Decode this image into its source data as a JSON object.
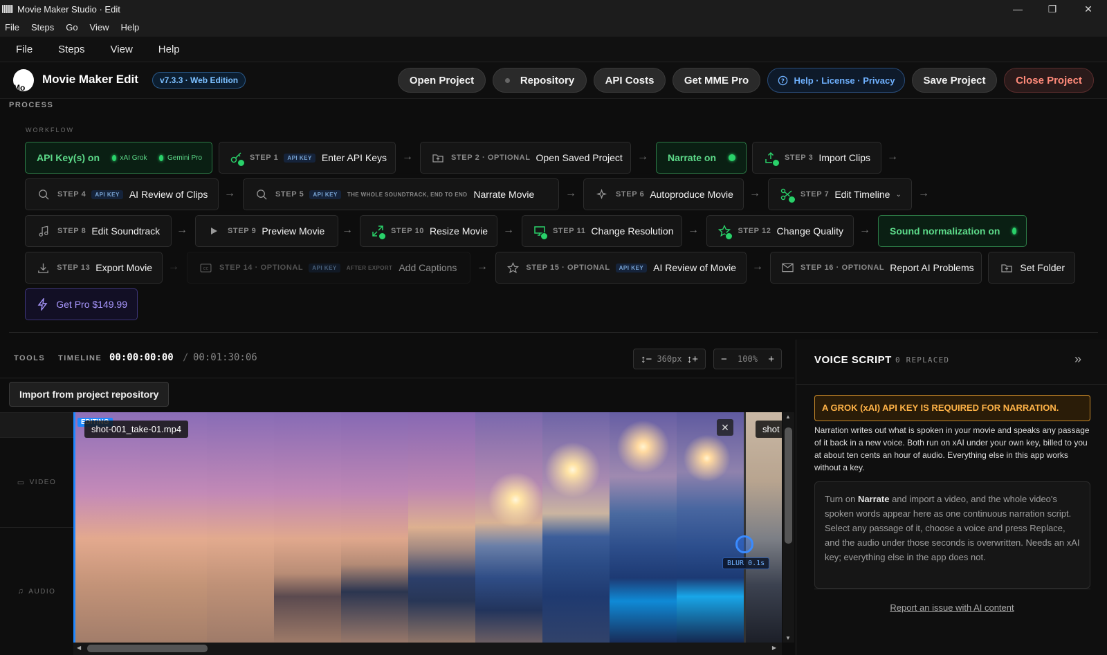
{
  "window": {
    "title": "Movie Maker Studio · Edit",
    "minimize": "—",
    "maximize": "❐",
    "close": "✕"
  },
  "menu_native": [
    "File",
    "Steps",
    "Go",
    "View",
    "Help"
  ],
  "menu_app": [
    "File",
    "Steps",
    "View",
    "Help"
  ],
  "header": {
    "logo_text": "Mo",
    "app_name": "Movie Maker Edit",
    "version": "v7.3.3 · Web Edition",
    "buttons": {
      "open_project": "Open Project",
      "repository": "Repository",
      "api_costs": "API Costs",
      "get_pro": "Get MME Pro",
      "help": "Help · License · Privacy",
      "save_project": "Save Project",
      "close_project": "Close Project"
    }
  },
  "process": {
    "label": "PROCESS",
    "workflow_label": "WORKFLOW",
    "api_keys": {
      "label": "API Key(s) on",
      "key1": "xAI Grok",
      "key2": "Gemini Pro"
    },
    "narrate_toggle": "Narrate on",
    "sound_toggle": "Sound normalization on",
    "steps": {
      "s1": {
        "step": "STEP 1",
        "badge": "API KEY",
        "label": "Enter API Keys"
      },
      "s2": {
        "step": "STEP 2 · OPTIONAL",
        "label": "Open Saved Project"
      },
      "s3": {
        "step": "STEP 3",
        "label": "Import Clips"
      },
      "s4": {
        "step": "STEP 4",
        "badge": "API KEY",
        "label": "AI Review of Clips"
      },
      "s5": {
        "step": "STEP 5",
        "badge": "API KEY",
        "hint": "THE WHOLE SOUNDTRACK, END TO END",
        "label": "Narrate Movie"
      },
      "s6": {
        "step": "STEP 6",
        "label": "Autoproduce Movie"
      },
      "s7": {
        "step": "STEP 7",
        "label": "Edit Timeline"
      },
      "s8": {
        "step": "STEP 8",
        "label": "Edit Soundtrack"
      },
      "s9": {
        "step": "STEP 9",
        "label": "Preview Movie"
      },
      "s10": {
        "step": "STEP 10",
        "label": "Resize Movie"
      },
      "s11": {
        "step": "STEP 11",
        "label": "Change Resolution"
      },
      "s12": {
        "step": "STEP 12",
        "label": "Change Quality"
      },
      "s13": {
        "step": "STEP 13",
        "label": "Export Movie"
      },
      "s14": {
        "step": "STEP 14 · OPTIONAL",
        "badge": "API KEY",
        "hint": "AFTER EXPORT",
        "label": "Add Captions"
      },
      "s15": {
        "step": "STEP 15 · OPTIONAL",
        "badge": "API KEY",
        "label": "AI Review of Movie"
      },
      "s16": {
        "step": "STEP 16 · OPTIONAL",
        "label": "Report AI Problems"
      }
    },
    "set_folder": "Set Folder",
    "get_pro": "Get Pro $149.99"
  },
  "timeline": {
    "tools_label": "TOOLS",
    "timeline_label": "TIMELINE",
    "current": "00:00:00:00",
    "divider": "/",
    "total": "00:01:30:06",
    "height_value": "360px",
    "zoom_value": "100%",
    "import_btn": "Import from project repository",
    "track_video": "VIDEO",
    "track_audio": "AUDIO",
    "editing_badge": "EDITING",
    "clip1_name": "shot-001_take-01.mp4",
    "clip2_name": "shot",
    "blur_label": "BLUR 0.1s"
  },
  "voice_script": {
    "title": "VOICE SCRIPT",
    "replaced": "0 REPLACED",
    "warning": "A GROK (xAI) API KEY IS REQUIRED FOR NARRATION.",
    "description": "Narration writes out what is spoken in your movie and speaks any passage of it back in a new voice. Both run on xAI under your own key, billed to you at about ten cents an hour of audio. Everything else in this app works without a key.",
    "box_pre": "Turn on ",
    "box_bold": "Narrate",
    "box_post": " and import a video, and the whole video's spoken words appear here as one continuous narration script. Select any passage of it, choose a voice and press Replace, and the audio under those seconds is overwritten. Needs an xAI key; everything else in the app does not.",
    "report_link": "Report an issue with AI content"
  },
  "colors": {
    "accent_green": "#2ad16a",
    "accent_blue": "#1e88ff",
    "warning": "#ffb347",
    "danger": "#ff8a7a",
    "pro_purple": "#a998ff"
  }
}
